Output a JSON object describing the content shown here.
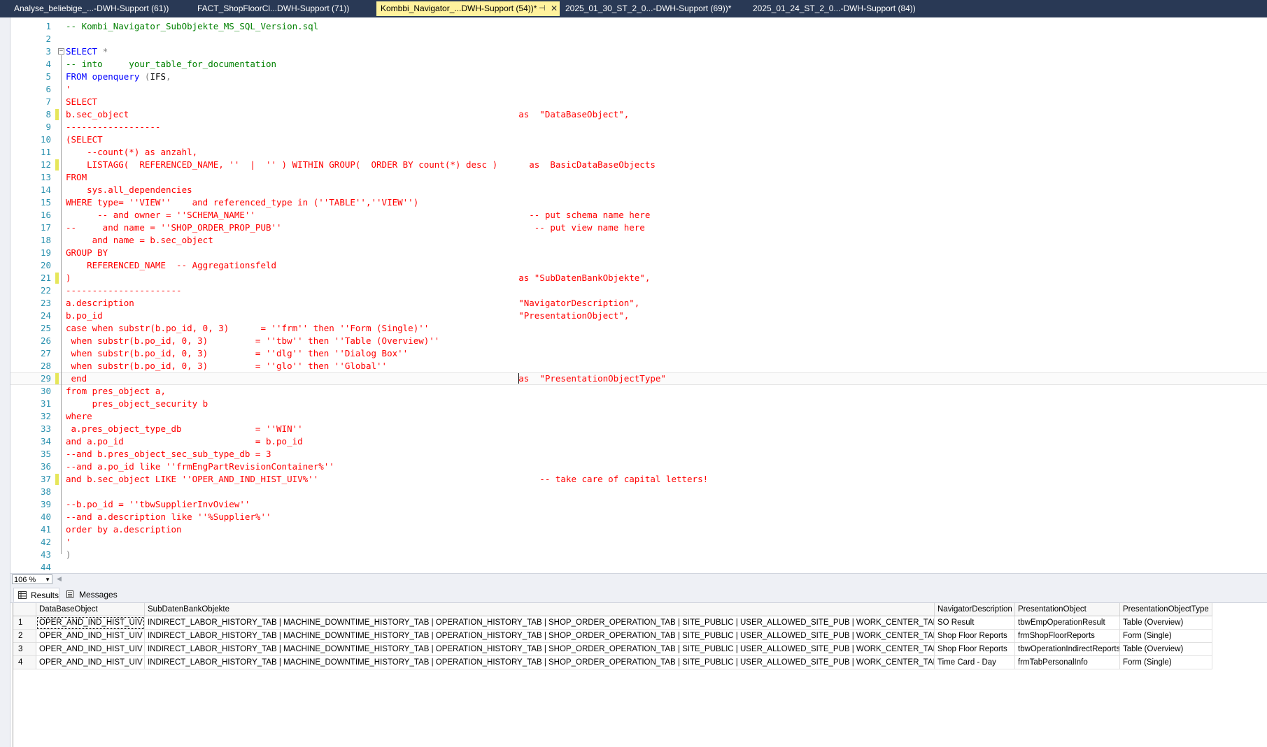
{
  "doc_tabs": [
    {
      "label": "Analyse_beliebige_...-DWH-Support (61))",
      "active": false
    },
    {
      "label": "FACT_ShopFloorCl...DWH-Support (71))",
      "active": false
    },
    {
      "label": "Kombbi_Navigator_...DWH-Support (54))*",
      "active": true
    },
    {
      "label": "2025_01_30_ST_2_0...-DWH-Support (69))*",
      "active": false
    },
    {
      "label": "2025_01_24_ST_2_0...-DWH-Support (84))",
      "active": false
    }
  ],
  "doc_tab_controls": {
    "pin": "⊣",
    "close": "✕"
  },
  "editor": {
    "lines": [
      {
        "n": "1",
        "tokens": [
          [
            "c",
            "-- Kombi_Navigator_SubObjekte_MS_SQL_Version.sql"
          ]
        ]
      },
      {
        "n": "2",
        "tokens": []
      },
      {
        "n": "3",
        "tokens": [
          [
            "k",
            "SELECT"
          ],
          [
            "p",
            " "
          ],
          [
            "g",
            "*"
          ]
        ],
        "fold": "−"
      },
      {
        "n": "4",
        "tokens": [
          [
            "c",
            "-- into     your_table_for_documentation"
          ]
        ]
      },
      {
        "n": "5",
        "tokens": [
          [
            "k",
            "FROM"
          ],
          [
            "p",
            " "
          ],
          [
            "k",
            "openquery"
          ],
          [
            "p",
            " "
          ],
          [
            "g",
            "("
          ],
          [
            "p",
            "IFS"
          ],
          [
            "g",
            ","
          ]
        ]
      },
      {
        "n": "6",
        "tokens": [
          [
            "s",
            "'"
          ]
        ]
      },
      {
        "n": "7",
        "tokens": [
          [
            "s",
            "SELECT"
          ]
        ]
      },
      {
        "n": "8",
        "tokens": [
          [
            "s",
            "b.sec_object                                                                          as  \"DataBaseObject\","
          ]
        ],
        "changed": true
      },
      {
        "n": "9",
        "tokens": [
          [
            "s",
            "------------------"
          ]
        ]
      },
      {
        "n": "10",
        "tokens": [
          [
            "s",
            "(SELECT"
          ]
        ]
      },
      {
        "n": "11",
        "tokens": [
          [
            "s",
            "    --count(*) as anzahl,"
          ]
        ]
      },
      {
        "n": "12",
        "tokens": [
          [
            "s",
            "    LISTAGG(  REFERENCED_NAME, ''  |  '' ) WITHIN GROUP(  ORDER BY count(*) desc )      as  BasicDataBaseObjects"
          ]
        ],
        "changed": true
      },
      {
        "n": "13",
        "tokens": [
          [
            "s",
            "FROM"
          ]
        ]
      },
      {
        "n": "14",
        "tokens": [
          [
            "s",
            "    sys.all_dependencies"
          ]
        ]
      },
      {
        "n": "15",
        "tokens": [
          [
            "s",
            "WHERE type= ''VIEW''    and referenced_type in (''TABLE'',''VIEW'')"
          ]
        ]
      },
      {
        "n": "16",
        "tokens": [
          [
            "s",
            "      -- and owner = ''SCHEMA_NAME''                                                    -- put schema name here"
          ]
        ]
      },
      {
        "n": "17",
        "tokens": [
          [
            "s",
            "--     and name = ''SHOP_ORDER_PROP_PUB''                                                -- put view name here"
          ]
        ]
      },
      {
        "n": "18",
        "tokens": [
          [
            "s",
            "     and name = b.sec_object"
          ]
        ]
      },
      {
        "n": "19",
        "tokens": [
          [
            "s",
            "GROUP BY"
          ]
        ]
      },
      {
        "n": "20",
        "tokens": [
          [
            "s",
            "    REFERENCED_NAME  -- Aggregationsfeld"
          ]
        ]
      },
      {
        "n": "21",
        "tokens": [
          [
            "s",
            ")                                                                                     as \"SubDatenBankObjekte\","
          ]
        ],
        "changed": true
      },
      {
        "n": "22",
        "tokens": [
          [
            "s",
            "----------------------"
          ]
        ]
      },
      {
        "n": "23",
        "tokens": [
          [
            "s",
            "a.description                                                                         \"NavigatorDescription\","
          ]
        ]
      },
      {
        "n": "24",
        "tokens": [
          [
            "s",
            "b.po_id                                                                               \"PresentationObject\","
          ]
        ]
      },
      {
        "n": "25",
        "tokens": [
          [
            "s",
            "case when substr(b.po_id, 0, 3)      = ''frm'' then ''Form (Single)''"
          ]
        ]
      },
      {
        "n": "26",
        "tokens": [
          [
            "s",
            " when substr(b.po_id, 0, 3)         = ''tbw'' then ''Table (Overview)''"
          ]
        ]
      },
      {
        "n": "27",
        "tokens": [
          [
            "s",
            " when substr(b.po_id, 0, 3)         = ''dlg'' then ''Dialog Box''"
          ]
        ]
      },
      {
        "n": "28",
        "tokens": [
          [
            "s",
            " when substr(b.po_id, 0, 3)         = ''glo'' then ''Global''"
          ]
        ]
      },
      {
        "n": "29",
        "tokens": [
          [
            "s",
            " end                                                                                  "
          ],
          [
            "caret",
            ""
          ],
          [
            "s",
            "as  \"PresentationObjectType\""
          ]
        ],
        "changed": true,
        "current": true
      },
      {
        "n": "30",
        "tokens": [
          [
            "s",
            "from pres_object a,"
          ]
        ]
      },
      {
        "n": "31",
        "tokens": [
          [
            "s",
            "     pres_object_security b"
          ]
        ]
      },
      {
        "n": "32",
        "tokens": [
          [
            "s",
            "where"
          ]
        ]
      },
      {
        "n": "33",
        "tokens": [
          [
            "s",
            " a.pres_object_type_db              = ''WIN''"
          ]
        ]
      },
      {
        "n": "34",
        "tokens": [
          [
            "s",
            "and a.po_id                         = b.po_id"
          ]
        ]
      },
      {
        "n": "35",
        "tokens": [
          [
            "s",
            "--and b.pres_object_sec_sub_type_db = 3"
          ]
        ]
      },
      {
        "n": "36",
        "tokens": [
          [
            "s",
            "--and a.po_id like ''frmEngPartRevisionContainer%''"
          ]
        ]
      },
      {
        "n": "37",
        "tokens": [
          [
            "s",
            "and b.sec_object LIKE ''OPER_AND_IND_HIST_UIV%''                                          -- take care of capital letters!"
          ]
        ],
        "changed": true
      },
      {
        "n": "38",
        "tokens": []
      },
      {
        "n": "39",
        "tokens": [
          [
            "s",
            "--b.po_id = ''tbwSupplierInvOview''"
          ]
        ]
      },
      {
        "n": "40",
        "tokens": [
          [
            "s",
            "--and a.description like ''%Supplier%''"
          ]
        ]
      },
      {
        "n": "41",
        "tokens": [
          [
            "s",
            "order by a.description"
          ]
        ]
      },
      {
        "n": "42",
        "tokens": [
          [
            "s",
            "'"
          ]
        ]
      },
      {
        "n": "43",
        "tokens": [
          [
            "g",
            ")"
          ]
        ]
      },
      {
        "n": "44",
        "tokens": []
      }
    ]
  },
  "zoom": {
    "value": "106 %"
  },
  "result_tabs": [
    {
      "label": "Results",
      "active": true,
      "icon": "grid-icon"
    },
    {
      "label": "Messages",
      "active": false,
      "icon": "messages-icon"
    }
  ],
  "grid": {
    "columns": [
      "DataBaseObject",
      "SubDatenBankObjekte",
      "NavigatorDescription",
      "PresentationObject",
      "PresentationObjectType"
    ],
    "rows": [
      [
        "1",
        "OPER_AND_IND_HIST_UIV",
        "INDIRECT_LABOR_HISTORY_TAB | MACHINE_DOWNTIME_HISTORY_TAB | OPERATION_HISTORY_TAB | SHOP_ORDER_OPERATION_TAB | SITE_PUBLIC | USER_ALLOWED_SITE_PUB | WORK_CENTER_TAB",
        "SO Result",
        "tbwEmpOperationResult",
        "Table (Overview)"
      ],
      [
        "2",
        "OPER_AND_IND_HIST_UIV",
        "INDIRECT_LABOR_HISTORY_TAB | MACHINE_DOWNTIME_HISTORY_TAB | OPERATION_HISTORY_TAB | SHOP_ORDER_OPERATION_TAB | SITE_PUBLIC | USER_ALLOWED_SITE_PUB | WORK_CENTER_TAB",
        "Shop Floor Reports",
        "frmShopFloorReports",
        "Form (Single)"
      ],
      [
        "3",
        "OPER_AND_IND_HIST_UIV",
        "INDIRECT_LABOR_HISTORY_TAB | MACHINE_DOWNTIME_HISTORY_TAB | OPERATION_HISTORY_TAB | SHOP_ORDER_OPERATION_TAB | SITE_PUBLIC | USER_ALLOWED_SITE_PUB | WORK_CENTER_TAB",
        "Shop Floor Reports",
        "tbwOperationIndirectReports",
        "Table (Overview)"
      ],
      [
        "4",
        "OPER_AND_IND_HIST_UIV",
        "INDIRECT_LABOR_HISTORY_TAB | MACHINE_DOWNTIME_HISTORY_TAB | OPERATION_HISTORY_TAB | SHOP_ORDER_OPERATION_TAB | SITE_PUBLIC | USER_ALLOWED_SITE_PUB | WORK_CENTER_TAB",
        "Time Card - Day",
        "frmTabPersonalInfo",
        "Form (Single)"
      ]
    ]
  }
}
